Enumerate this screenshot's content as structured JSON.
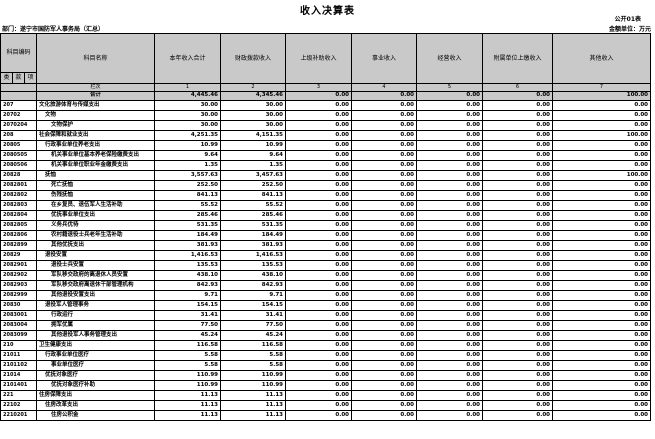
{
  "title": "收入决算表",
  "form_no": "公开01表",
  "dept": "部门：遂宁市国防军人事务局（汇总）",
  "unit": "金额单位：万元",
  "headers": {
    "code": "科目编码",
    "name": "科目名称",
    "cols": [
      "本年收入合计",
      "财政拨款收入",
      "上级补助收入",
      "事业收入",
      "经营收入",
      "附属单位上缴收入",
      "其他收入"
    ],
    "sub": [
      "类",
      "款",
      "项"
    ]
  },
  "seq": {
    "label": "栏次",
    "nums": [
      "1",
      "2",
      "3",
      "4",
      "5",
      "6",
      "7"
    ]
  },
  "total": {
    "label": "合计",
    "values": [
      "4,445.46",
      "4,345.46",
      "0.00",
      "0.00",
      "0.00",
      "0.00",
      "100.00"
    ]
  },
  "rows": [
    {
      "code": "207",
      "name": "文化旅游体育与传媒支出",
      "ind": 0,
      "v": [
        "30.00",
        "30.00",
        "0.00",
        "0.00",
        "0.00",
        "0.00",
        "0.00"
      ]
    },
    {
      "code": "20702",
      "name": "文物",
      "ind": 1,
      "v": [
        "30.00",
        "30.00",
        "0.00",
        "0.00",
        "0.00",
        "0.00",
        "0.00"
      ]
    },
    {
      "code": "2070204",
      "name": "文物保护",
      "ind": 2,
      "v": [
        "30.00",
        "30.00",
        "0.00",
        "0.00",
        "0.00",
        "0.00",
        "0.00"
      ]
    },
    {
      "code": "208",
      "name": "社会保障和就业支出",
      "ind": 0,
      "v": [
        "4,251.35",
        "4,151.35",
        "0.00",
        "0.00",
        "0.00",
        "0.00",
        "100.00"
      ]
    },
    {
      "code": "20805",
      "name": "行政事业单位养老支出",
      "ind": 1,
      "v": [
        "10.99",
        "10.99",
        "0.00",
        "0.00",
        "0.00",
        "0.00",
        "0.00"
      ]
    },
    {
      "code": "2080505",
      "name": "机关事业单位基本养老保险缴费支出",
      "ind": 2,
      "v": [
        "9.64",
        "9.64",
        "0.00",
        "0.00",
        "0.00",
        "0.00",
        "0.00"
      ]
    },
    {
      "code": "2080506",
      "name": "机关事业单位职业年金缴费支出",
      "ind": 2,
      "v": [
        "1.35",
        "1.35",
        "0.00",
        "0.00",
        "0.00",
        "0.00",
        "0.00"
      ]
    },
    {
      "code": "20828",
      "name": "抚恤",
      "ind": 1,
      "v": [
        "3,557.63",
        "3,457.63",
        "0.00",
        "0.00",
        "0.00",
        "0.00",
        "100.00"
      ]
    },
    {
      "code": "2082801",
      "name": "死亡抚恤",
      "ind": 2,
      "v": [
        "252.50",
        "252.50",
        "0.00",
        "0.00",
        "0.00",
        "0.00",
        "0.00"
      ]
    },
    {
      "code": "2082802",
      "name": "伤残抚恤",
      "ind": 2,
      "v": [
        "841.13",
        "841.13",
        "0.00",
        "0.00",
        "0.00",
        "0.00",
        "0.00"
      ]
    },
    {
      "code": "2082803",
      "name": "在乡复员、退伍军人生活补助",
      "ind": 2,
      "v": [
        "55.52",
        "55.52",
        "0.00",
        "0.00",
        "0.00",
        "0.00",
        "0.00"
      ]
    },
    {
      "code": "2082804",
      "name": "优抚事业单位支出",
      "ind": 2,
      "v": [
        "285.46",
        "285.46",
        "0.00",
        "0.00",
        "0.00",
        "0.00",
        "0.00"
      ]
    },
    {
      "code": "2082805",
      "name": "义务兵优待",
      "ind": 2,
      "v": [
        "531.35",
        "531.35",
        "0.00",
        "0.00",
        "0.00",
        "0.00",
        "0.00"
      ]
    },
    {
      "code": "2082806",
      "name": "农村籍退役士兵老年生活补助",
      "ind": 2,
      "v": [
        "184.49",
        "184.49",
        "0.00",
        "0.00",
        "0.00",
        "0.00",
        "0.00"
      ]
    },
    {
      "code": "2082899",
      "name": "其他优抚支出",
      "ind": 2,
      "v": [
        "381.93",
        "381.93",
        "0.00",
        "0.00",
        "0.00",
        "0.00",
        "0.00"
      ]
    },
    {
      "code": "20829",
      "name": "退役安置",
      "ind": 1,
      "v": [
        "1,416.53",
        "1,416.53",
        "0.00",
        "0.00",
        "0.00",
        "0.00",
        "0.00"
      ]
    },
    {
      "code": "2082901",
      "name": "退役士兵安置",
      "ind": 2,
      "v": [
        "135.53",
        "135.53",
        "0.00",
        "0.00",
        "0.00",
        "0.00",
        "0.00"
      ]
    },
    {
      "code": "2082902",
      "name": "军队移交政府的离退休人员安置",
      "ind": 2,
      "v": [
        "438.10",
        "438.10",
        "0.00",
        "0.00",
        "0.00",
        "0.00",
        "0.00"
      ]
    },
    {
      "code": "2082903",
      "name": "军队移交政府离退休干部管理机构",
      "ind": 2,
      "v": [
        "842.93",
        "842.93",
        "0.00",
        "0.00",
        "0.00",
        "0.00",
        "0.00"
      ]
    },
    {
      "code": "2082999",
      "name": "其他退役安置支出",
      "ind": 2,
      "v": [
        "9.71",
        "9.71",
        "0.00",
        "0.00",
        "0.00",
        "0.00",
        "0.00"
      ]
    },
    {
      "code": "20830",
      "name": "退役军人管理事务",
      "ind": 1,
      "v": [
        "154.15",
        "154.15",
        "0.00",
        "0.00",
        "0.00",
        "0.00",
        "0.00"
      ]
    },
    {
      "code": "2083001",
      "name": "行政运行",
      "ind": 2,
      "v": [
        "31.41",
        "31.41",
        "0.00",
        "0.00",
        "0.00",
        "0.00",
        "0.00"
      ]
    },
    {
      "code": "2083004",
      "name": "拥军优属",
      "ind": 2,
      "v": [
        "77.50",
        "77.50",
        "0.00",
        "0.00",
        "0.00",
        "0.00",
        "0.00"
      ]
    },
    {
      "code": "2083099",
      "name": "其他退役军人事务管理支出",
      "ind": 2,
      "v": [
        "45.24",
        "45.24",
        "0.00",
        "0.00",
        "0.00",
        "0.00",
        "0.00"
      ]
    },
    {
      "code": "210",
      "name": "卫生健康支出",
      "ind": 0,
      "v": [
        "116.58",
        "116.58",
        "0.00",
        "0.00",
        "0.00",
        "0.00",
        "0.00"
      ]
    },
    {
      "code": "21011",
      "name": "行政事业单位医疗",
      "ind": 1,
      "v": [
        "5.58",
        "5.58",
        "0.00",
        "0.00",
        "0.00",
        "0.00",
        "0.00"
      ]
    },
    {
      "code": "2101102",
      "name": "事业单位医疗",
      "ind": 2,
      "v": [
        "5.58",
        "5.58",
        "0.00",
        "0.00",
        "0.00",
        "0.00",
        "0.00"
      ]
    },
    {
      "code": "21014",
      "name": "优抚对象医疗",
      "ind": 1,
      "v": [
        "110.99",
        "110.99",
        "0.00",
        "0.00",
        "0.00",
        "0.00",
        "0.00"
      ]
    },
    {
      "code": "2101401",
      "name": "优抚对象医疗补助",
      "ind": 2,
      "v": [
        "110.99",
        "110.99",
        "0.00",
        "0.00",
        "0.00",
        "0.00",
        "0.00"
      ]
    },
    {
      "code": "221",
      "name": "住房保障支出",
      "ind": 0,
      "v": [
        "11.13",
        "11.13",
        "0.00",
        "0.00",
        "0.00",
        "0.00",
        "0.00"
      ]
    },
    {
      "code": "22102",
      "name": "住房改革支出",
      "ind": 1,
      "v": [
        "11.13",
        "11.13",
        "0.00",
        "0.00",
        "0.00",
        "0.00",
        "0.00"
      ]
    },
    {
      "code": "2210201",
      "name": "住房公积金",
      "ind": 2,
      "v": [
        "11.13",
        "11.13",
        "0.00",
        "0.00",
        "0.00",
        "0.00",
        "0.00"
      ]
    }
  ]
}
